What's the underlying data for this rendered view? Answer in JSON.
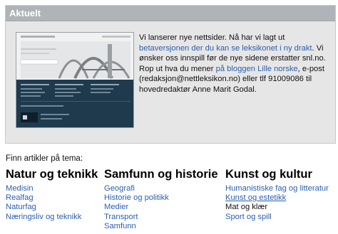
{
  "news": {
    "header": "Aktuelt",
    "text": {
      "p1": "Vi lanserer nye nettsider. Nå har vi lagt ut ",
      "link1": "betaversjonen der du kan se leksikonet i ny drakt",
      "p2": ". Vi ønsker oss innspill før de nye sidene erstatter snl.no. Rop ut hva du mener ",
      "link2": "på bloggen Lille norske",
      "p3": ", e-post (redaksjon@nettleksikon.no) eller tlf 91009086 til hovedredaktør Anne Marit Godal."
    }
  },
  "topics": {
    "intro": "Finn artikler på tema:",
    "columns": [
      {
        "title": "Natur og teknikk",
        "items": [
          "Medisin",
          "Realfag",
          "Naturfag",
          "Næringsliv og teknikk"
        ]
      },
      {
        "title": "Samfunn og historie",
        "items": [
          "Geografi",
          "Historie og politikk",
          "Medier",
          "Transport",
          "Samfunn"
        ]
      },
      {
        "title": "Kunst og kultur",
        "items": [
          "Humanistiske fag og litteratur",
          "Kunst og estetikk",
          "Mat og klær",
          "Sport og spill"
        ]
      }
    ]
  },
  "colors": {
    "header_bg": "#aeb4b8",
    "box_bg": "#e6e6e6",
    "link": "#2a5fb0",
    "preview_dark": "#1f3a4d"
  }
}
